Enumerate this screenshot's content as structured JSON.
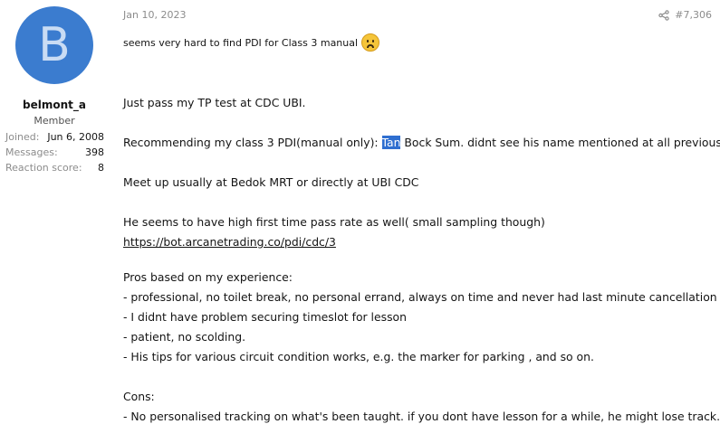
{
  "user": {
    "avatar_letter": "B",
    "avatar_color": "#3b7ccf",
    "username": "belmont_a",
    "title": "Member",
    "stats": [
      {
        "label": "Joined:",
        "value": "Jun 6, 2008"
      },
      {
        "label": "Messages:",
        "value": "398"
      },
      {
        "label": "Reaction score:",
        "value": "8"
      }
    ]
  },
  "post": {
    "date": "Jan 10, 2023",
    "share_icon": "share-icon",
    "number": "#7,306",
    "snippet": "seems very hard to find PDI for Class 3 manual",
    "snippet_emoji": "frowning-emoji",
    "lines": {
      "l1": "Just pass my TP test at CDC UBI.",
      "l2_pre": "Recommending my class 3 PDI(manual only): ",
      "l2_sel": "Tan",
      "l2_post": " Bock Sum. didnt see his name mentioned at all previously.",
      "l3": "Meet up usually at Bedok MRT or directly at UBI CDC",
      "l4": "He seems to have high first time pass rate as well( small sampling though)",
      "link": "https://bot.arcanetrading.co/pdi/cdc/3",
      "l5": "Pros based on my experience:",
      "l6": "- professional, no toilet break, no personal errand, always on time and never had last minute cancellation",
      "l7": "- I didnt have problem securing timeslot for lesson",
      "l8": "- patient, no scolding.",
      "l9": "- His tips for various circuit condition works, e.g. the marker for parking , and so on.",
      "l10": "Cons:",
      "l11": "- No personalised tracking on what's been taught. if you dont have lesson for a while, he might lose track."
    }
  }
}
